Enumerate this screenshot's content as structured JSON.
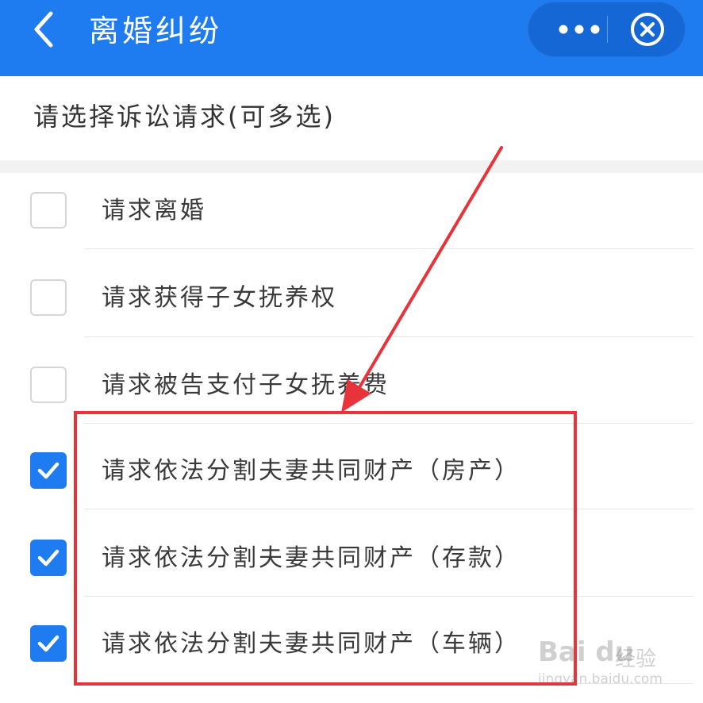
{
  "header": {
    "title": "离婚纠纷",
    "back_icon": "chevron-left-icon",
    "more_icon": "more-dots-icon",
    "close_icon": "close-circle-icon",
    "background_color": "#1f7cf0"
  },
  "prompt": "请选择诉讼请求(可多选)",
  "options": [
    {
      "label": "请求离婚",
      "checked": false
    },
    {
      "label": "请求获得子女抚养权",
      "checked": false
    },
    {
      "label": "请求被告支付子女抚养费",
      "checked": false
    },
    {
      "label": "请求依法分割夫妻共同财产（房产）",
      "checked": true
    },
    {
      "label": "请求依法分割夫妻共同财产（存款）",
      "checked": true
    },
    {
      "label": "请求依法分割夫妻共同财产（车辆）",
      "checked": true
    }
  ],
  "annotation": {
    "highlight_color": "#e8333a"
  },
  "watermark": {
    "logo": "Bai du",
    "text": "经验",
    "url": "jingyan.baidu.com"
  }
}
